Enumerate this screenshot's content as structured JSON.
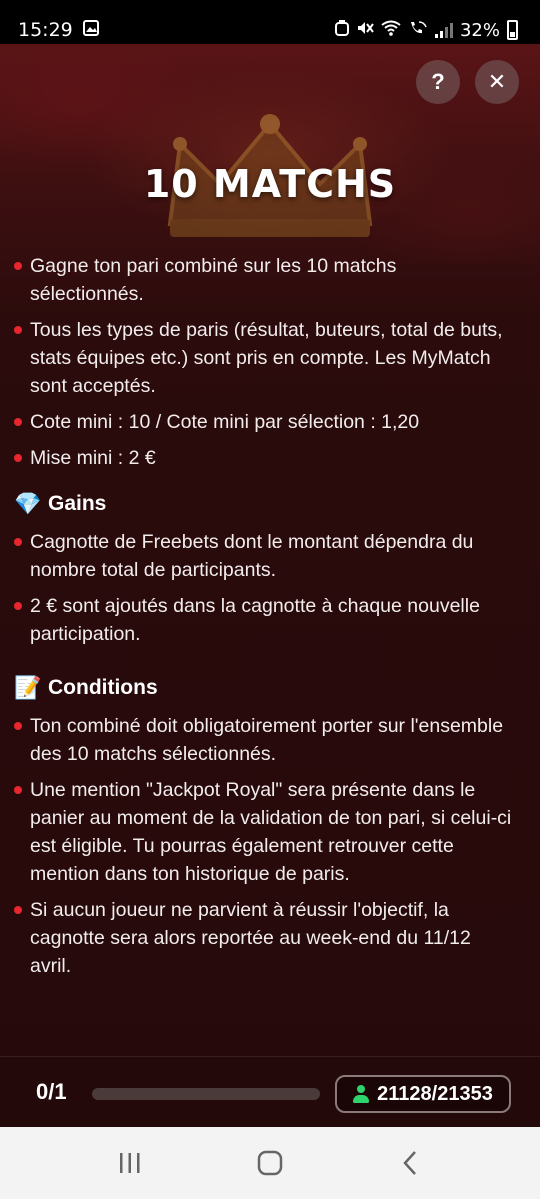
{
  "status_bar": {
    "time": "15:29",
    "battery": "32%",
    "icons": [
      "image-icon",
      "silent-icon",
      "wifi-icon",
      "wifi-call-icon",
      "signal-icon",
      "battery-icon"
    ]
  },
  "header": {
    "help_label": "?",
    "close_label": "✕",
    "title": "10 MATCHS"
  },
  "rules": [
    "Gagne ton pari combiné sur les 10 matchs sélectionnés.",
    "Tous les types de paris (résultat, buteurs, total de buts, stats équipes etc.) sont pris en compte. Les MyMatch sont acceptés.",
    "Cote mini : 10 / Cote mini par sélection : 1,20",
    "Mise mini : 2 €"
  ],
  "gains": {
    "emoji": "💎",
    "heading": "Gains",
    "items": [
      "Cagnotte de Freebets dont le montant dépendra du nombre total de participants.",
      "2 € sont ajoutés dans la cagnotte à chaque nouvelle participation."
    ]
  },
  "conditions": {
    "emoji": "📝",
    "heading": "Conditions",
    "items": [
      "Ton combiné doit obligatoirement porter sur l'ensemble des 10 matchs sélectionnés.",
      "Une mention \"Jackpot Royal\" sera présente dans le panier au moment de la validation de ton pari, si celui-ci est éligible. Tu pourras également retrouver cette mention dans ton historique de paris.",
      "Si aucun joueur ne parvient à réussir l'objectif, la cagnotte sera alors reportée au week-end du 11/12 avril."
    ]
  },
  "footer": {
    "progress_text": "0/1",
    "progress_fraction": 0,
    "participants": "21128/21353"
  },
  "colors": {
    "bullet": "#e8262d",
    "participants_icon": "#2fd36b"
  }
}
